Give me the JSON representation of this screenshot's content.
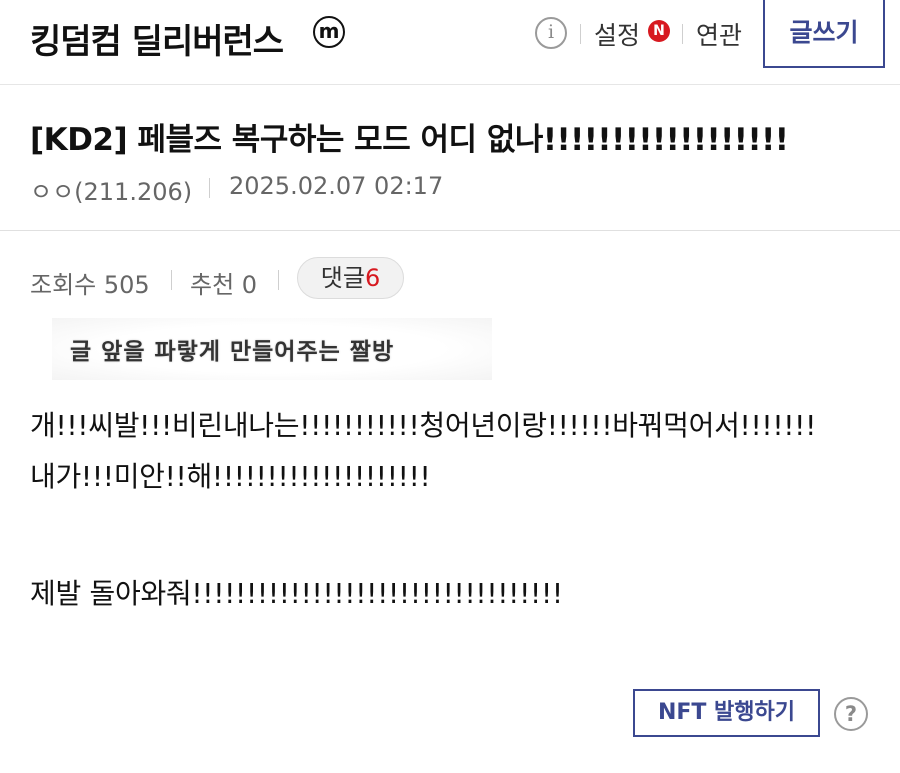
{
  "header": {
    "gallery_title": "킹덤컴 딜리버런스",
    "minor_badge": "m",
    "info_icon": "i",
    "settings_label": "설정",
    "settings_badge": "N",
    "related_label": "연관",
    "write_label": "글쓰기"
  },
  "post": {
    "title": "[KD2] 페블즈 복구하는 모드 어디 없나!!!!!!!!!!!!!!!!!!",
    "author": "ㅇㅇ(211.206)",
    "date": "2025.02.07 02:17",
    "stats": {
      "views_label": "조회수 505",
      "recommend_label": "추천 0",
      "comments_label": "댓글",
      "comments_count": "6"
    },
    "caption_image_text": "글 앞을 파랗게 만들어주는 짤방",
    "body_lines": [
      "개!!!씨발!!!비린내나는!!!!!!!!!!!청어년이랑!!!!!!바꿔먹어서!!!!!!!",
      "내가!!!미안!!해!!!!!!!!!!!!!!!!!!!!",
      "제발 돌아와줘!!!!!!!!!!!!!!!!!!!!!!!!!!!!!!!!!!"
    ]
  },
  "footer": {
    "nft_label": "NFT 발행하기",
    "help_icon": "?"
  },
  "colors": {
    "accent": "#3b4890",
    "badge_red": "#d71920",
    "muted_text": "#666666"
  },
  "icons": [
    "minor-gallery-badge-icon",
    "info-icon",
    "new-badge-icon",
    "help-icon"
  ]
}
